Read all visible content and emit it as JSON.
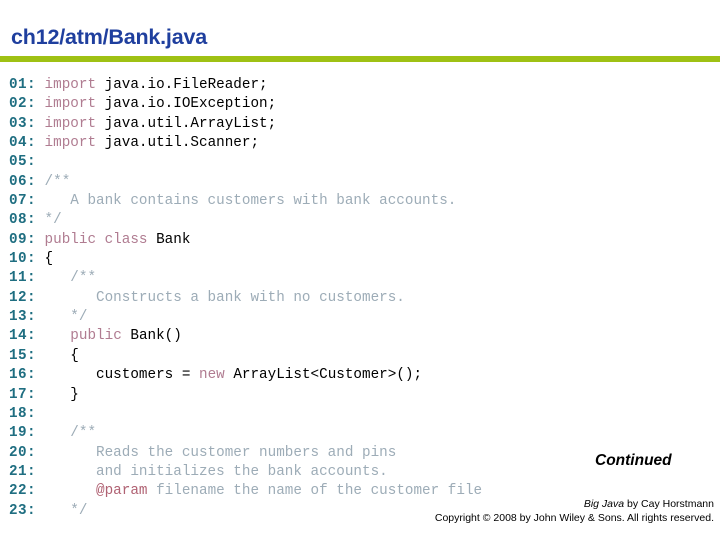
{
  "slide": {
    "title": "ch12/atm/Bank.java",
    "accent_color": "#9FC114",
    "title_color": "#1F3F9E",
    "line_number_color": "#1F6E81",
    "keyword_color": "#B07C91",
    "comment_color": "#9DACB7",
    "code_color": "#000000"
  },
  "code": {
    "lines": [
      {
        "num": "01:",
        "tokens": [
          {
            "t": "kw",
            "v": "import"
          },
          {
            "t": "src",
            "v": " java.io.FileReader;"
          }
        ]
      },
      {
        "num": "02:",
        "tokens": [
          {
            "t": "kw",
            "v": "import"
          },
          {
            "t": "src",
            "v": " java.io.IOException;"
          }
        ]
      },
      {
        "num": "03:",
        "tokens": [
          {
            "t": "kw",
            "v": "import"
          },
          {
            "t": "src",
            "v": " java.util.ArrayList;"
          }
        ]
      },
      {
        "num": "04:",
        "tokens": [
          {
            "t": "kw",
            "v": "import"
          },
          {
            "t": "src",
            "v": " java.util.Scanner;"
          }
        ]
      },
      {
        "num": "05:",
        "tokens": []
      },
      {
        "num": "06:",
        "tokens": [
          {
            "t": "cm",
            "v": "/**"
          }
        ]
      },
      {
        "num": "07:",
        "tokens": [
          {
            "t": "cm",
            "v": "   A bank contains customers with bank accounts."
          }
        ]
      },
      {
        "num": "08:",
        "tokens": [
          {
            "t": "cm",
            "v": "*/"
          }
        ]
      },
      {
        "num": "09:",
        "tokens": [
          {
            "t": "kw",
            "v": "public class"
          },
          {
            "t": "src",
            "v": " Bank"
          }
        ]
      },
      {
        "num": "10:",
        "tokens": [
          {
            "t": "src",
            "v": "{"
          }
        ]
      },
      {
        "num": "11:",
        "tokens": [
          {
            "t": "cm",
            "v": "   /**"
          }
        ]
      },
      {
        "num": "12:",
        "tokens": [
          {
            "t": "cm",
            "v": "      Constructs a bank with no customers."
          }
        ]
      },
      {
        "num": "13:",
        "tokens": [
          {
            "t": "cm",
            "v": "   */"
          }
        ]
      },
      {
        "num": "14:",
        "tokens": [
          {
            "t": "src",
            "v": "   "
          },
          {
            "t": "kw",
            "v": "public"
          },
          {
            "t": "src",
            "v": " Bank()"
          }
        ]
      },
      {
        "num": "15:",
        "tokens": [
          {
            "t": "src",
            "v": "   {"
          }
        ]
      },
      {
        "num": "16:",
        "tokens": [
          {
            "t": "src",
            "v": "      customers = "
          },
          {
            "t": "kw",
            "v": "new"
          },
          {
            "t": "src",
            "v": " ArrayList<Customer>();"
          }
        ]
      },
      {
        "num": "17:",
        "tokens": [
          {
            "t": "src",
            "v": "   }"
          }
        ]
      },
      {
        "num": "18:",
        "tokens": []
      },
      {
        "num": "19:",
        "tokens": [
          {
            "t": "cm",
            "v": "   /**"
          }
        ]
      },
      {
        "num": "20:",
        "tokens": [
          {
            "t": "cm",
            "v": "      Reads the customer numbers and pins"
          }
        ]
      },
      {
        "num": "21:",
        "tokens": [
          {
            "t": "cm",
            "v": "      and initializes the bank accounts."
          }
        ]
      },
      {
        "num": "22:",
        "tokens": [
          {
            "t": "tag",
            "v": "      @param"
          },
          {
            "t": "cm",
            "v": " filename the name of the customer file"
          }
        ]
      },
      {
        "num": "23:",
        "tokens": [
          {
            "t": "cm",
            "v": "   */"
          }
        ]
      }
    ]
  },
  "continued": {
    "label": "Continued"
  },
  "footer": {
    "book_title": "Big Java",
    "credit_rest": " by Cay Horstmann",
    "copyright": "Copyright © 2008 by John Wiley & Sons.  All rights reserved."
  }
}
